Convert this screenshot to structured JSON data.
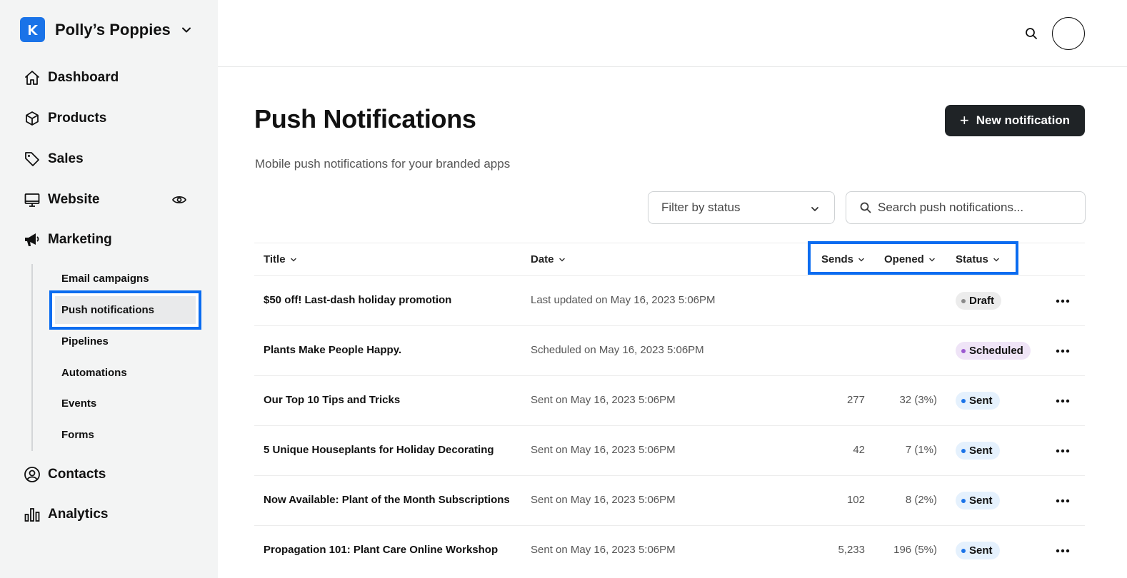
{
  "workspace": {
    "name": "Polly’s Poppies"
  },
  "nav": {
    "items": [
      {
        "key": "dashboard",
        "label": "Dashboard"
      },
      {
        "key": "products",
        "label": "Products"
      },
      {
        "key": "sales",
        "label": "Sales"
      },
      {
        "key": "website",
        "label": "Website"
      },
      {
        "key": "marketing",
        "label": "Marketing"
      },
      {
        "key": "contacts",
        "label": "Contacts"
      },
      {
        "key": "analytics",
        "label": "Analytics"
      }
    ],
    "marketing_sub": [
      {
        "label": "Email campaigns"
      },
      {
        "label": "Push notifications",
        "active": true
      },
      {
        "label": "Pipelines"
      },
      {
        "label": "Automations"
      },
      {
        "label": "Events"
      },
      {
        "label": "Forms"
      }
    ]
  },
  "page": {
    "title": "Push Notifications",
    "subtitle": "Mobile push notifications for your branded apps",
    "new_button": "New notification",
    "filter_label": "Filter by status",
    "search_placeholder": "Search push notifications..."
  },
  "table": {
    "columns": {
      "title": "Title",
      "date": "Date",
      "sends": "Sends",
      "opened": "Opened",
      "status": "Status"
    },
    "rows": [
      {
        "title": "$50 off! Last-dash holiday promotion",
        "date": "Last updated on May 16, 2023 5:06PM",
        "sends": "",
        "opened": "",
        "status": "Draft"
      },
      {
        "title": "Plants Make People Happy.",
        "date": "Scheduled on May 16, 2023 5:06PM",
        "sends": "",
        "opened": "",
        "status": "Scheduled"
      },
      {
        "title": "Our Top 10 Tips and Tricks",
        "date": "Sent on May 16, 2023 5:06PM",
        "sends": "277",
        "opened": "32 (3%)",
        "status": "Sent"
      },
      {
        "title": "5 Unique Houseplants for Holiday Decorating",
        "date": "Sent on May 16, 2023 5:06PM",
        "sends": "42",
        "opened": "7 (1%)",
        "status": "Sent"
      },
      {
        "title": "Now Available: Plant of the Month Subscriptions",
        "date": "Sent on May 16, 2023 5:06PM",
        "sends": "102",
        "opened": "8 (2%)",
        "status": "Sent"
      },
      {
        "title": "Propagation 101: Plant Care Online Workshop",
        "date": "Sent on May 16, 2023 5:06PM",
        "sends": "5,233",
        "opened": "196 (5%)",
        "status": "Sent"
      }
    ]
  },
  "colors": {
    "accent": "#0a6cf0",
    "brand": "#1a73e8",
    "draft_bg": "#ececec",
    "draft_dot": "#8a8a8a",
    "scheduled_bg": "#efe4f7",
    "scheduled_dot": "#9b59d0",
    "sent_bg": "#e5f1fd",
    "sent_dot": "#1a73e8"
  },
  "icons": {
    "dashboard": "house-icon",
    "products": "box-icon",
    "sales": "tag-icon",
    "website": "monitor-icon",
    "marketing": "megaphone-icon",
    "contacts": "user-circle-icon",
    "analytics": "bar-chart-icon",
    "visibility": "eye-icon",
    "search": "search-icon",
    "more": "ellipsis-icon"
  }
}
